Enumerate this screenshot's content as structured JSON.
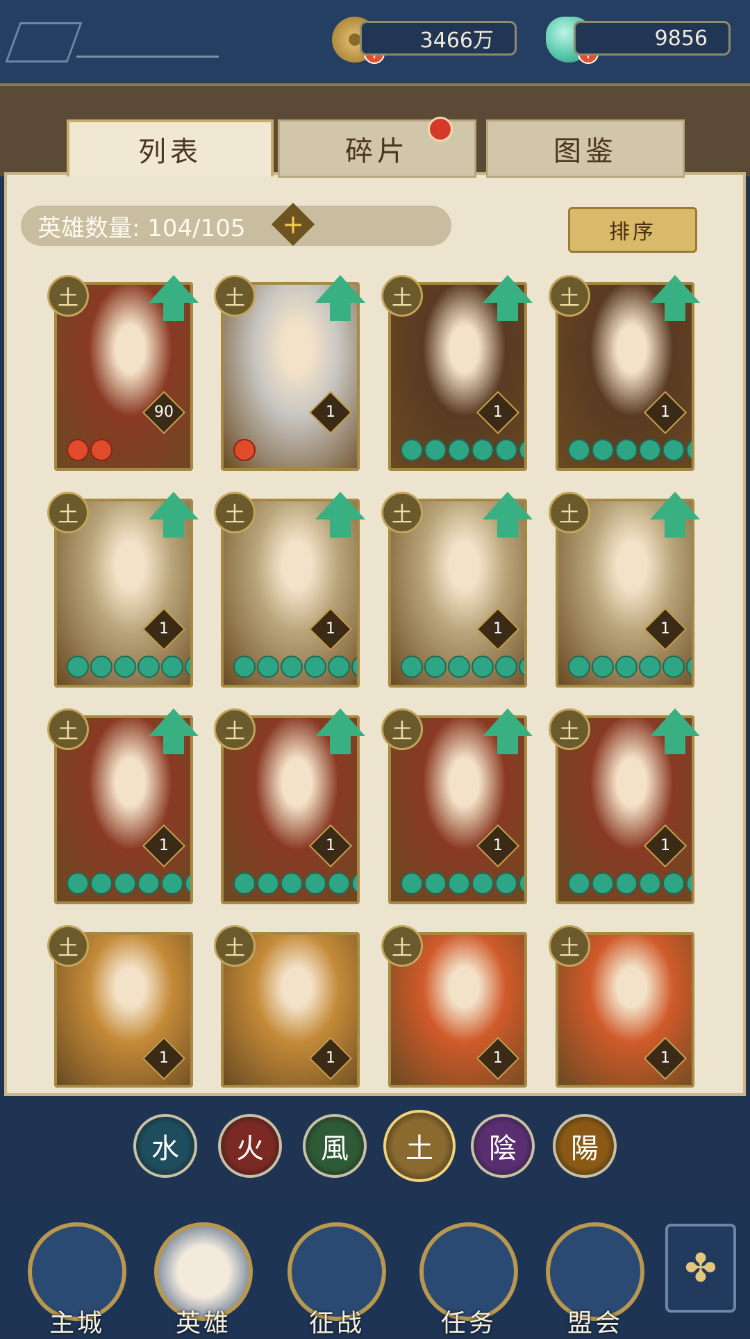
{
  "resources": {
    "coins": {
      "icon": "copper-coin-icon",
      "value": "3466万"
    },
    "gems": {
      "icon": "jade-shell-icon",
      "value": "9856"
    }
  },
  "tabs": [
    {
      "label": "列表",
      "active": true
    },
    {
      "label": "碎片",
      "active": false,
      "has_badge": true
    },
    {
      "label": "图鉴",
      "active": false
    }
  ],
  "hero_count": {
    "label": "英雄数量: 104/105"
  },
  "sort_label": "排序",
  "heroes": [
    {
      "element": "土",
      "level": "90",
      "stars": 2,
      "star_color": "red",
      "can_upgrade": true,
      "palette": "#8a3a24"
    },
    {
      "element": "土",
      "level": "1",
      "stars": 1,
      "star_color": "red",
      "can_upgrade": true,
      "palette": "#c8c6c2"
    },
    {
      "element": "土",
      "level": "1",
      "stars": 6,
      "star_color": "green",
      "can_upgrade": true,
      "palette": "#5a3a22"
    },
    {
      "element": "土",
      "level": "1",
      "stars": 6,
      "star_color": "green",
      "can_upgrade": true,
      "palette": "#5a3a22"
    },
    {
      "element": "土",
      "level": "1",
      "stars": 6,
      "star_color": "green",
      "can_upgrade": true,
      "palette": "#b9a57a"
    },
    {
      "element": "土",
      "level": "1",
      "stars": 6,
      "star_color": "green",
      "can_upgrade": true,
      "palette": "#b9a57a"
    },
    {
      "element": "土",
      "level": "1",
      "stars": 6,
      "star_color": "green",
      "can_upgrade": true,
      "palette": "#b9a57a"
    },
    {
      "element": "土",
      "level": "1",
      "stars": 6,
      "star_color": "green",
      "can_upgrade": true,
      "palette": "#b9a57a"
    },
    {
      "element": "土",
      "level": "1",
      "stars": 6,
      "star_color": "green",
      "can_upgrade": true,
      "palette": "#8a3a24"
    },
    {
      "element": "土",
      "level": "1",
      "stars": 6,
      "star_color": "green",
      "can_upgrade": true,
      "palette": "#8a3a24"
    },
    {
      "element": "土",
      "level": "1",
      "stars": 6,
      "star_color": "green",
      "can_upgrade": true,
      "palette": "#8a3a24"
    },
    {
      "element": "土",
      "level": "1",
      "stars": 6,
      "star_color": "green",
      "can_upgrade": true,
      "palette": "#8a3a24"
    },
    {
      "element": "土",
      "level": "1",
      "stars": 0,
      "star_color": "green",
      "can_upgrade": false,
      "palette": "#c48a38"
    },
    {
      "element": "土",
      "level": "1",
      "stars": 0,
      "star_color": "green",
      "can_upgrade": false,
      "palette": "#c48a38"
    },
    {
      "element": "土",
      "level": "1",
      "stars": 0,
      "star_color": "green",
      "can_upgrade": false,
      "palette": "#d05a2a"
    },
    {
      "element": "土",
      "level": "1",
      "stars": 0,
      "star_color": "green",
      "can_upgrade": false,
      "palette": "#d05a2a"
    }
  ],
  "element_filters": [
    {
      "glyph": "水",
      "color": "#1d4d5e",
      "selected": false
    },
    {
      "glyph": "火",
      "color": "#7a2a22",
      "selected": false
    },
    {
      "glyph": "風",
      "color": "#2e5a36",
      "selected": false
    },
    {
      "glyph": "土",
      "color": "#8a6a2e",
      "selected": true
    },
    {
      "glyph": "陰",
      "color": "#5a2f72",
      "selected": false
    },
    {
      "glyph": "陽",
      "color": "#8a5a14",
      "selected": false
    }
  ],
  "nav": [
    {
      "label": "主城",
      "icon": "city-gate-icon"
    },
    {
      "label": "英雄",
      "icon": "hero-portrait-icon",
      "active": true
    },
    {
      "label": "征战",
      "icon": "war-horn-icon"
    },
    {
      "label": "任务",
      "icon": "scroll-icon"
    },
    {
      "label": "盟会",
      "icon": "alliance-hall-icon"
    }
  ],
  "more_icon": "clover-menu-icon"
}
